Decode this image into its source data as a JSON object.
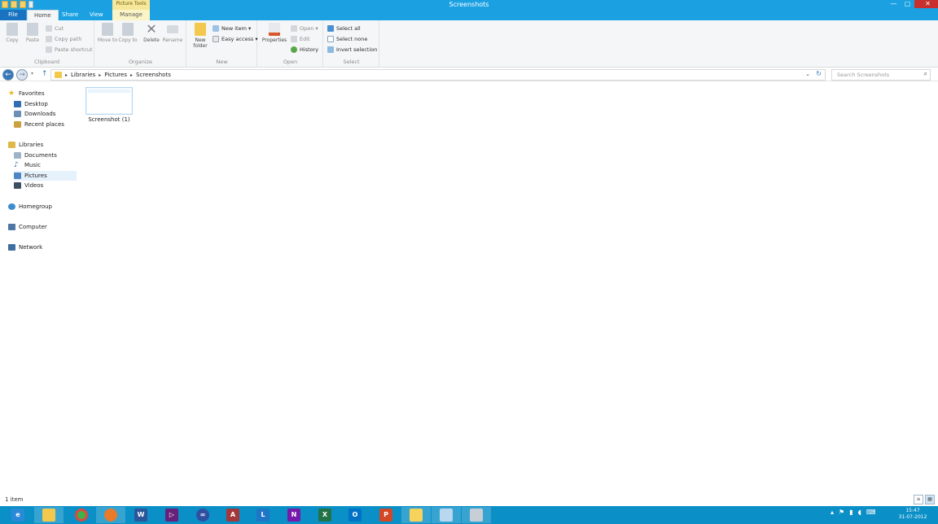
{
  "window": {
    "title": "Screenshots",
    "context_tab": "Picture Tools",
    "controls": {
      "minimize": "—",
      "maximize": "▢",
      "close": "✕"
    }
  },
  "tabs": {
    "file": "File",
    "home": "Home",
    "share": "Share",
    "view": "View",
    "manage": "Manage"
  },
  "ribbon": {
    "clipboard": {
      "copy": "Copy",
      "paste": "Paste",
      "cut": "Cut",
      "copy_path": "Copy path",
      "paste_shortcut": "Paste shortcut",
      "label": "Clipboard"
    },
    "organize": {
      "move_to": "Move to",
      "copy_to": "Copy to",
      "delete": "Delete",
      "rename": "Rename",
      "label": "Organize"
    },
    "new": {
      "new_folder": "New folder",
      "new_item": "New item ▾",
      "easy_access": "Easy access ▾",
      "label": "New"
    },
    "open": {
      "properties": "Properties",
      "open": "Open ▾",
      "edit": "Edit",
      "history": "History",
      "label": "Open"
    },
    "select": {
      "select_all": "Select all",
      "select_none": "Select none",
      "invert_selection": "Invert selection",
      "label": "Select"
    }
  },
  "address": {
    "crumbs": [
      "Libraries",
      "Pictures",
      "Screenshots"
    ],
    "search_placeholder": "Search Screenshots"
  },
  "nav": {
    "favorites": "Favorites",
    "desktop": "Desktop",
    "downloads": "Downloads",
    "recent_places": "Recent places",
    "libraries": "Libraries",
    "documents": "Documents",
    "music": "Music",
    "pictures": "Pictures",
    "videos": "Videos",
    "homegroup": "Homegroup",
    "computer": "Computer",
    "network": "Network"
  },
  "files": [
    {
      "name": "Screenshot (1)"
    }
  ],
  "status": {
    "item_count": "1 item"
  },
  "taskbar": {
    "apps": [
      "ie-icon",
      "explorer-icon",
      "chrome-icon",
      "firefox-icon",
      "word-icon",
      "visual-studio-icon",
      "app-icon",
      "access-icon",
      "lync-icon",
      "onenote-icon",
      "excel-icon",
      "outlook-icon",
      "powerpoint-icon",
      "folder-icon",
      "app2-icon",
      "app3-icon"
    ],
    "clock_time": "15:47",
    "clock_date": "31-07-2012"
  },
  "colors": {
    "accent": "#1ba1e2",
    "file_tab": "#1a73c1",
    "taskbar": "#0b8fc7",
    "close": "#c7302e"
  }
}
